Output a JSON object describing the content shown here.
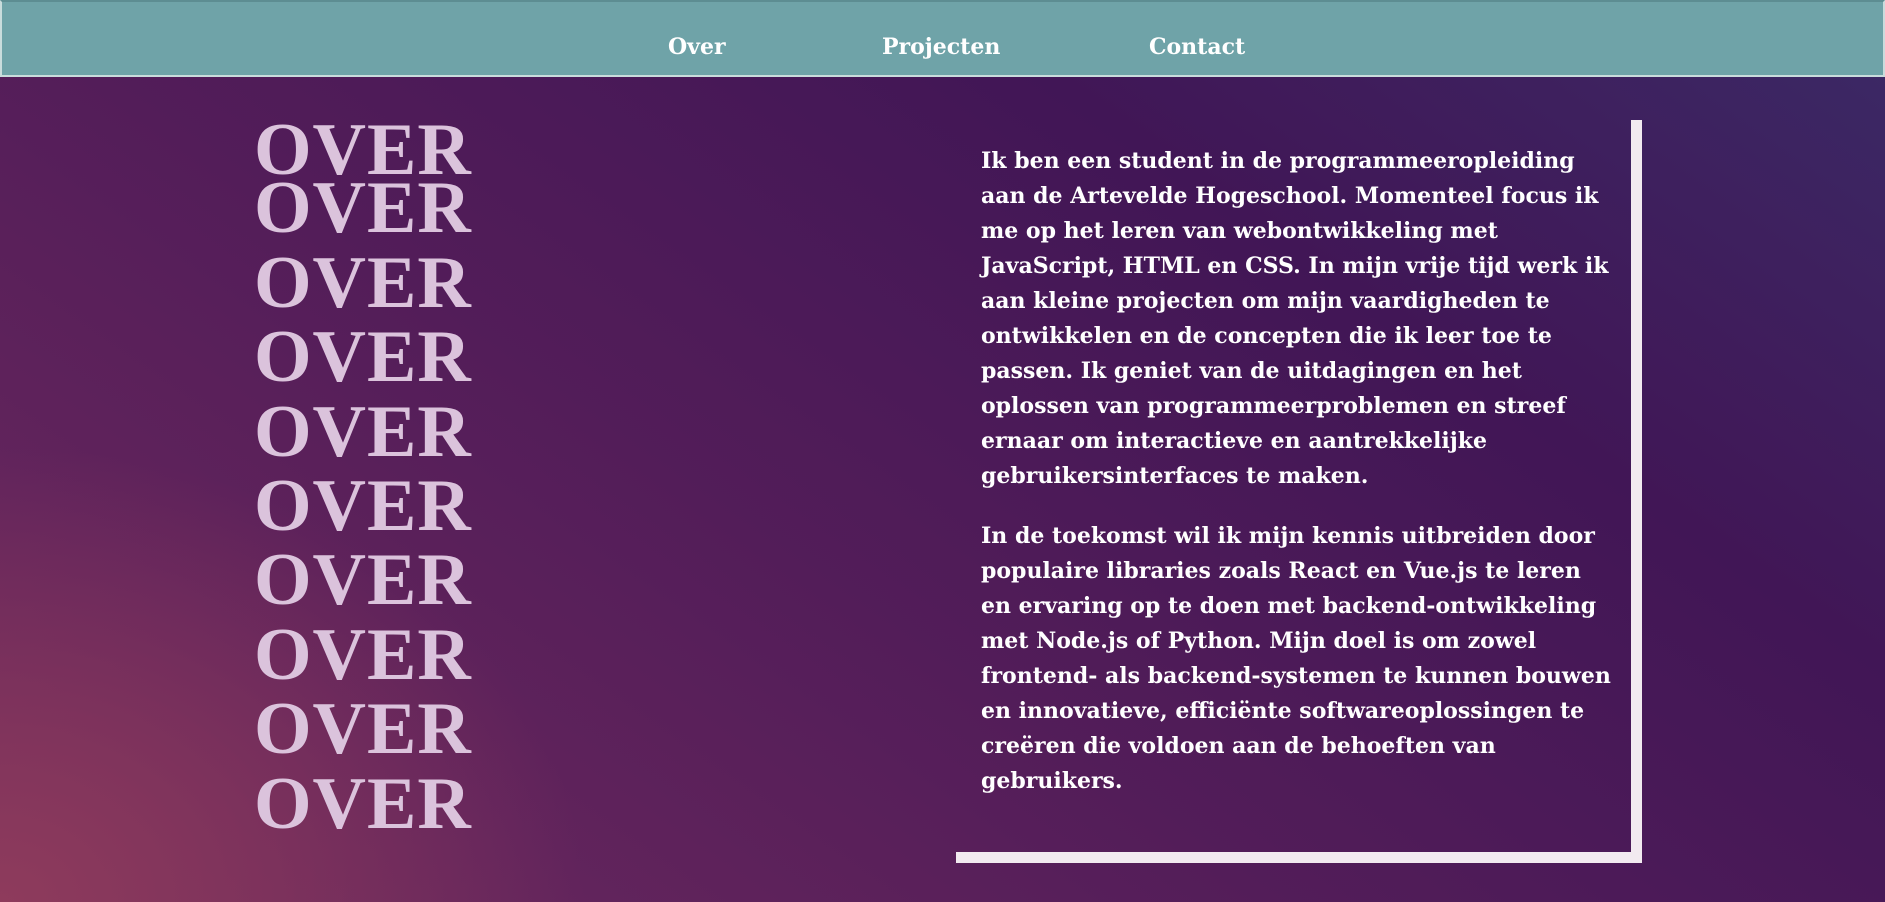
{
  "nav": {
    "items": [
      {
        "label": "Over"
      },
      {
        "label": "Projecten"
      },
      {
        "label": "Contact"
      }
    ]
  },
  "hero": {
    "repeated_word": "OVER",
    "repeat_count": 10
  },
  "about": {
    "paragraphs": [
      "Ik ben een student in de programmeeropleiding aan de Artevelde Hogeschool. Momenteel focus ik me op het leren van webontwikkeling met JavaScript, HTML en CSS. In mijn vrije tijd werk ik aan kleine projecten om mijn vaardigheden te ontwikkelen en de concepten die ik leer toe te passen. Ik geniet van de uitdagingen en het oplossen van programmeerproblemen en streef ernaar om interactieve en aantrekkelijke gebruikersinterfaces te maken.",
      "In de toekomst wil ik mijn kennis uitbreiden door populaire libraries zoals React en Vue.js te leren en ervaring op te doen met backend-ontwikkeling met Node.js of Python. Mijn doel is om zowel frontend- als backend-systemen te kunnen bouwen en innovatieve, efficiënte softwareoplossingen te creëren die voldoen aan de behoeften van gebruikers."
    ]
  },
  "colors": {
    "navbar": "#6fa3a8",
    "over_text": "#dbc3dc",
    "box_border": "#f2eaf0",
    "background_top_right": "#3b2a66",
    "background_bottom_left": "#8e3b5c"
  }
}
